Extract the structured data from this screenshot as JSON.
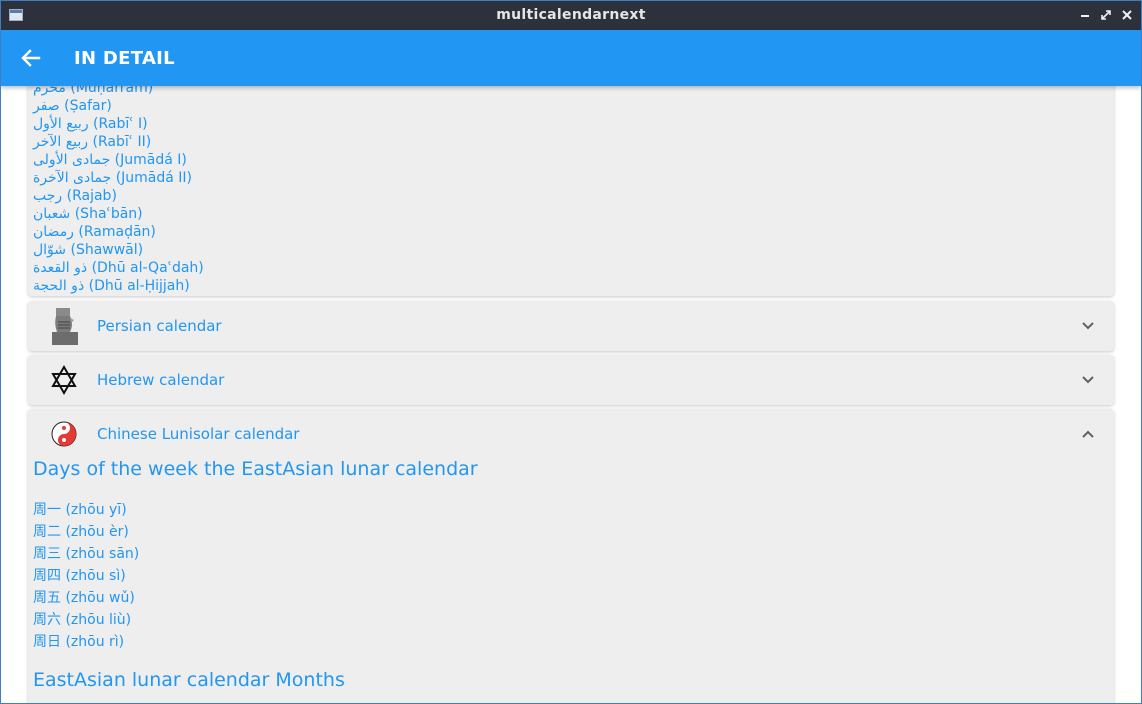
{
  "window": {
    "title": "multicalendarnext"
  },
  "appbar": {
    "title": "IN DETAIL"
  },
  "islamic_months": [
    "محرم (Muḥarram)",
    "صفر (Ṣafar)",
    "ربيع الأول (Rabīʿ I)",
    "ربيع الآخر (Rabīʿ II)",
    "جمادى الأولى (Jumādá I)",
    "جمادى الآخرة (Jumādá II)",
    "رجب (Rajab)",
    "شعبان (Shaʿbān)",
    "رمضان (Ramaḍān)",
    "شوّال (Shawwāl)",
    "ذو القعدة (Dhū al-Qaʿdah)",
    "ذو الحجة (Dhū al-Ḥijjah)"
  ],
  "panels": {
    "persian": {
      "title": "Persian calendar",
      "icon": "persian-bust-icon"
    },
    "hebrew": {
      "title": "Hebrew calendar",
      "icon": "star-of-david-icon"
    },
    "chinese": {
      "title": "Chinese Lunisolar calendar",
      "icon": "yin-yang-icon"
    }
  },
  "chinese": {
    "days_title": "Days of the week the EastAsian lunar calendar",
    "days": [
      "周一 (zhōu yī)",
      "周二 (zhōu èr)",
      "周三 (zhōu sān)",
      "周四 (zhōu sì)",
      "周五 (zhōu wǔ)",
      "周六 (zhōu liù)",
      "周日 (zhōu rì)"
    ],
    "months_title": "EastAsian lunar calendar Months"
  },
  "colors": {
    "accent": "#2196f3",
    "titlebar": "#2c313b",
    "card": "#eeeeee"
  }
}
